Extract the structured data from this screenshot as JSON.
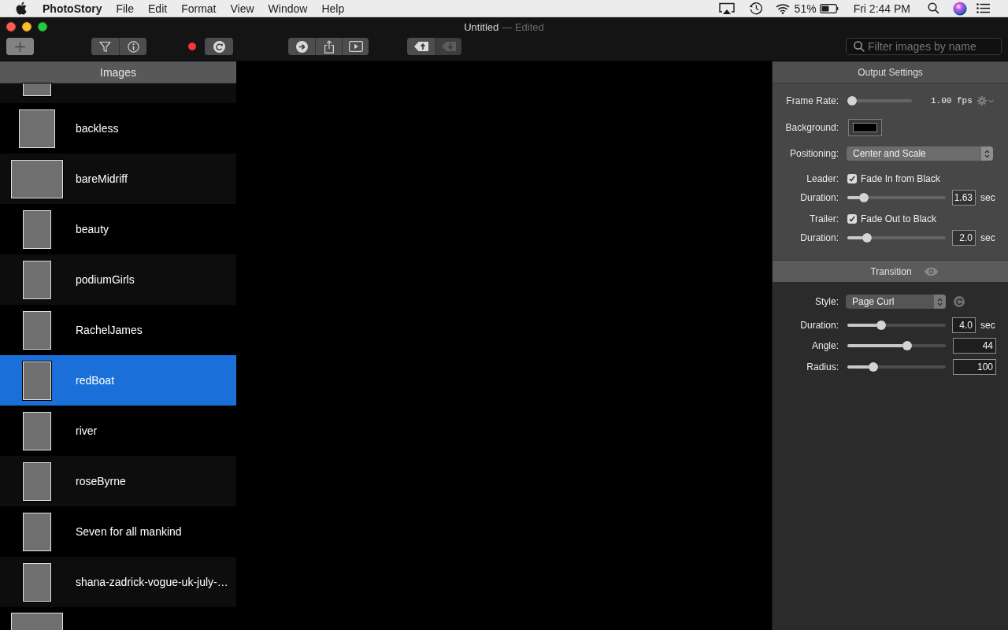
{
  "menu_bar": {
    "app_name": "PhotoStory",
    "menus": [
      "File",
      "Edit",
      "Format",
      "View",
      "Window",
      "Help"
    ],
    "battery": "51%",
    "clock": "Fri 2:44 PM"
  },
  "window": {
    "title": "Untitled",
    "status": "— Edited"
  },
  "toolbar": {
    "tag_buttons": [
      {
        "disabled": false
      },
      {
        "disabled": true
      }
    ],
    "search": {
      "placeholder": "Filter images by name"
    }
  },
  "sidebar": {
    "title": "Images",
    "items": [
      {
        "kind": "portrait",
        "selected": false
      },
      {
        "name": "backless",
        "kind": "square",
        "selected": false
      },
      {
        "name": "bareMidriff",
        "kind": "landscape",
        "selected": false
      },
      {
        "name": "beauty",
        "kind": "portrait",
        "selected": false
      },
      {
        "name": "podiumGirls",
        "kind": "portrait",
        "selected": false
      },
      {
        "name": "RachelJames",
        "kind": "portrait",
        "selected": false
      },
      {
        "name": "redBoat",
        "kind": "portrait",
        "selected": true
      },
      {
        "name": "river",
        "kind": "portrait",
        "selected": false
      },
      {
        "name": "roseByrne",
        "kind": "portrait",
        "selected": false
      },
      {
        "name": "Seven for all mankind",
        "kind": "portrait",
        "selected": false
      },
      {
        "name": "shana-zadrick-vogue-uk-july-…",
        "kind": "portrait",
        "selected": false
      },
      {
        "kind": "landscape",
        "selected": false
      }
    ]
  },
  "output_settings": {
    "title": "Output Settings",
    "rows": [
      {
        "kind": "rate",
        "label": "Frame Rate:",
        "level": 0,
        "reading": "1.00 fps"
      },
      {
        "kind": "color",
        "label": "Background:"
      },
      {
        "kind": "popup",
        "label": "Positioning:",
        "value": "Center and Scale"
      },
      {
        "kind": "checkbox",
        "label": "Leader:",
        "text": "Fade In from Black",
        "checked": true
      },
      {
        "kind": "slider",
        "label": "Duration:",
        "level": 0.13,
        "value": "1.63",
        "unit": "sec"
      },
      {
        "kind": "checkbox",
        "label": "Trailer:",
        "text": "Fade Out to Black",
        "checked": true
      },
      {
        "kind": "slider",
        "label": "Duration:",
        "level": 0.17,
        "value": "2.0",
        "unit": "sec"
      }
    ]
  },
  "transition": {
    "title": "Transition",
    "rows": [
      {
        "kind": "picker",
        "label": "Style:",
        "value": "Page Curl"
      },
      {
        "kind": "slider",
        "label": "Duration:",
        "level": 0.33,
        "value": "4.0",
        "unit": "sec"
      },
      {
        "kind": "slider",
        "label": "Angle:",
        "level": 0.62,
        "value": "44"
      },
      {
        "kind": "slider",
        "label": "Radius:",
        "level": 0.24,
        "value": "100"
      }
    ]
  }
}
